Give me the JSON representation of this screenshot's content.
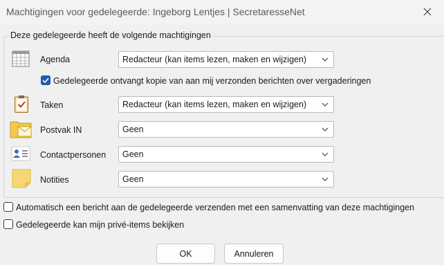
{
  "window": {
    "title": "Machtigingen voor gedelegeerde: Ingeborg Lentjes | SecretaresseNet",
    "close_icon": "close-icon"
  },
  "group": {
    "legend": "Deze gedelegeerde heeft de volgende machtigingen"
  },
  "rows": {
    "agenda": {
      "icon": "calendar-icon",
      "label": "Agenda",
      "value": "Redacteur (kan items lezen, maken en wijzigen)"
    },
    "taken": {
      "icon": "task-clipboard-icon",
      "label": "Taken",
      "value": "Redacteur (kan items lezen, maken en wijzigen)"
    },
    "postvak": {
      "icon": "inbox-folder-icon",
      "label": "Postvak IN",
      "value": "Geen"
    },
    "contacten": {
      "icon": "contacts-icon",
      "label": "Contactpersonen",
      "value": "Geen"
    },
    "notities": {
      "icon": "note-icon",
      "label": "Notities",
      "value": "Geen"
    }
  },
  "options": {
    "copy_meetings": {
      "label": "Gedelegeerde ontvangt kopie van aan mij verzonden berichten over vergaderingen",
      "checked": true
    },
    "auto_message": {
      "label": "Automatisch een bericht aan de gedelegeerde verzenden met een samenvatting van deze machtigingen",
      "checked": false
    },
    "private_items": {
      "label": "Gedelegeerde kan mijn privé-items bekijken",
      "checked": false
    }
  },
  "buttons": {
    "ok": "OK",
    "cancel": "Annuleren"
  },
  "colors": {
    "accent": "#1f5ea8",
    "dialog_bg": "#f0f0f0"
  }
}
